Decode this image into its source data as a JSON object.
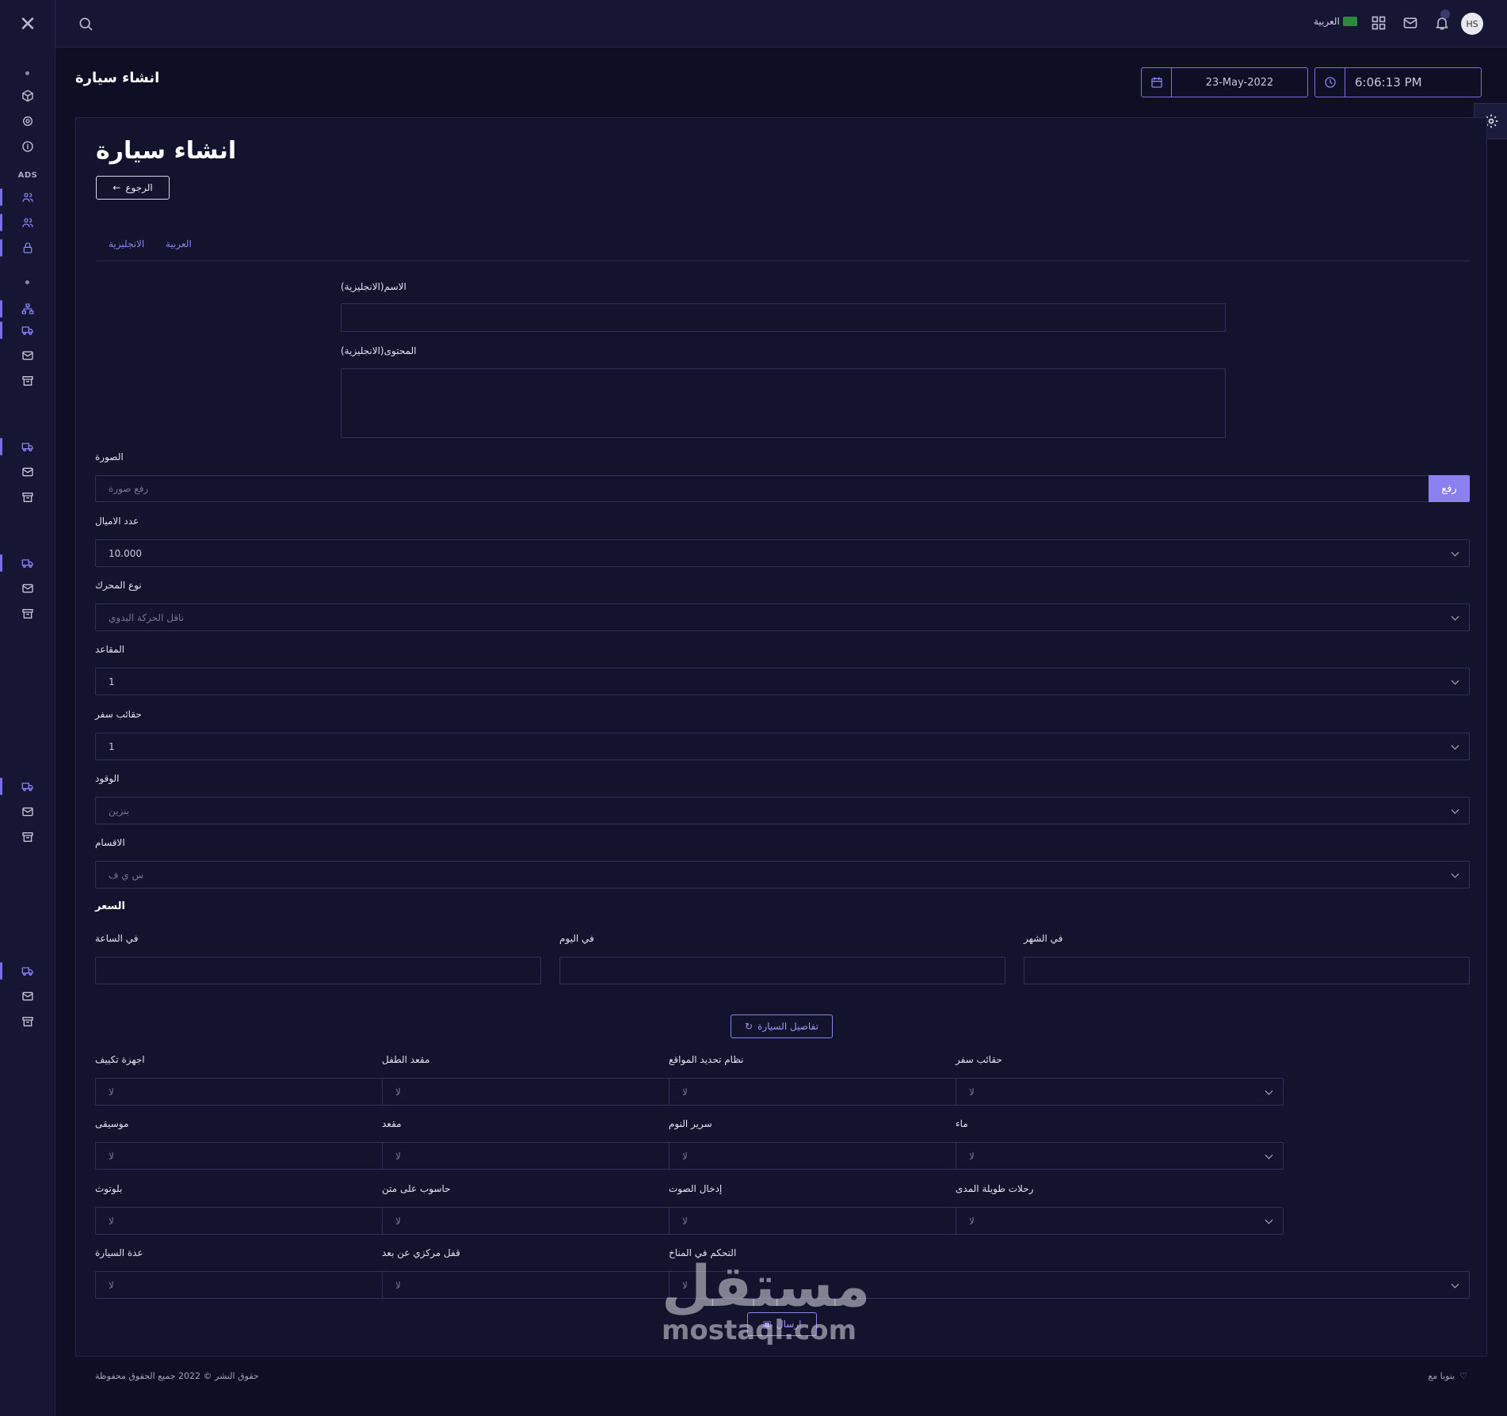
{
  "topbar": {
    "language": "العربية",
    "avatar_initials": "HS"
  },
  "sidebar": {
    "section_label": "ADS"
  },
  "header": {
    "title": "انشاء سيارة",
    "date": "23-May-2022",
    "time": "6:06:13 PM"
  },
  "form": {
    "heading": "انشاء سيارة",
    "back_label": "الرجوع",
    "tabs": [
      "الانجليزية",
      "العربية"
    ],
    "name_en_label": "الاسم(الانجليزية)",
    "content_en_label": "المحتوى(الانجليزية)",
    "image_label": "الصورة",
    "image_placeholder": "رفع صورة",
    "upload_label": "رفع",
    "mileage_label": "عدد الاميال",
    "mileage_value": "10.000",
    "engine_label": "نوع المحرك",
    "engine_value": "ناقل الحركة اليدوي",
    "seats_label": "المقاعد",
    "seats_value": "1",
    "bags_label": "حقائب سفر",
    "bags_value": "1",
    "fuel_label": "الوقود",
    "fuel_value": "بنزين",
    "category_label": "الاقسام",
    "category_value": "س ي ف",
    "price_title": "السعر",
    "price_hour_label": "في الساعة",
    "price_day_label": "في اليوم",
    "price_month_label": "في الشهر",
    "details_button": "تفاصيل السيارة",
    "details": [
      {
        "label": "اجهزة تكييف",
        "value": "لا"
      },
      {
        "label": "مقعد الطفل",
        "value": "لا"
      },
      {
        "label": "نظام تحديد المواقع",
        "value": "لا"
      },
      {
        "label": "حقائب سفر",
        "value": "لا"
      },
      {
        "label": "موسيقى",
        "value": "لا"
      },
      {
        "label": "مقعد",
        "value": "لا"
      },
      {
        "label": "سرير النوم",
        "value": "لا"
      },
      {
        "label": "ماء",
        "value": "لا"
      },
      {
        "label": "بلوتوث",
        "value": "لا"
      },
      {
        "label": "حاسوب على متن",
        "value": "لا"
      },
      {
        "label": "إدخال الصوت",
        "value": "لا"
      },
      {
        "label": "رحلات طويلة المدى",
        "value": "لا"
      },
      {
        "label": "عدة السيارة",
        "value": "لا"
      },
      {
        "label": "قفل مركزي عن بعد",
        "value": "لا"
      },
      {
        "label": "التحكم في المناخ",
        "value": "لا"
      }
    ],
    "submit_label": "ارسال"
  },
  "footer": {
    "copyright": "حقوق النشر © 2022 جميع الحقوق محفوظة",
    "made_with": "بنويا مع"
  },
  "watermark": {
    "arabic": "مستقل",
    "latin": "mostaql.com"
  }
}
